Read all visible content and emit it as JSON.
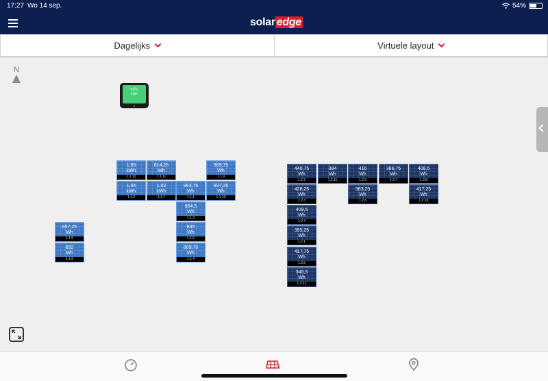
{
  "status": {
    "time": "17:27",
    "date": "Wo 14 sep.",
    "battery": "54%"
  },
  "app": {
    "logo_prefix": "solar",
    "logo_suffix": "edge",
    "accent": "#e11c2a",
    "navy": "#0c1f4f"
  },
  "selectors": {
    "period": "Dagelijks",
    "layout": "Virtuele layout"
  },
  "compass": {
    "label": "N"
  },
  "inverter": {
    "screen_line1": "≈/≈",
    "screen_line2": "kWh",
    "tag": "1"
  },
  "panels": [
    {
      "val": "1,05",
      "unit": "kWh",
      "id": "1.1.10"
    },
    {
      "val": "814,25",
      "unit": "Wh",
      "id": "1.1.11"
    },
    {
      "val": "989,75",
      "unit": "Wh",
      "id": "1.1.9"
    },
    {
      "val": "1,04",
      "unit": "kWh",
      "id": "1.1.2"
    },
    {
      "val": "1,02",
      "unit": "kWh",
      "id": "1.1.7"
    },
    {
      "val": "993,75",
      "unit": "Wh",
      "id": "1.1.1"
    },
    {
      "val": "937,25",
      "unit": "Wh",
      "id": "1.1.10"
    },
    {
      "val": "864,5",
      "unit": "Wh",
      "id": "1.1.3"
    },
    {
      "val": "845",
      "unit": "Wh",
      "id": "1.1.6"
    },
    {
      "val": "809,75",
      "unit": "Wh",
      "id": "1.1.4"
    },
    {
      "val": "857,25",
      "unit": "Wh",
      "id": "1.1.5"
    },
    {
      "val": "832",
      "unit": "Wh",
      "id": "1.1.8"
    },
    {
      "val": "440,75",
      "unit": "Wh",
      "id": "1.2.2"
    },
    {
      "val": "384",
      "unit": "Wh",
      "id": "1.2.11"
    },
    {
      "val": "416",
      "unit": "Wh",
      "id": "1.2.9"
    },
    {
      "val": "386,75",
      "unit": "Wh",
      "id": "1.2.7"
    },
    {
      "val": "408,5",
      "unit": "Wh",
      "id": "1.2.8"
    },
    {
      "val": "428,25",
      "unit": "Wh",
      "id": "1.2.3"
    },
    {
      "val": "383,25",
      "unit": "Wh",
      "id": "1.2.6"
    },
    {
      "val": "417,25",
      "unit": "Wh",
      "id": "1.2.10"
    },
    {
      "val": "409,5",
      "unit": "Wh",
      "id": "1.2.4"
    },
    {
      "val": "395,25",
      "unit": "Wh",
      "id": "1.2.1"
    },
    {
      "val": "417,75",
      "unit": "Wh",
      "id": "1.2.5"
    },
    {
      "val": "340,5",
      "unit": "Wh",
      "id": "1.2.12"
    }
  ],
  "tabs": [
    {
      "icon": "gauge-icon"
    },
    {
      "icon": "solar-panel-icon",
      "active": true
    },
    {
      "icon": "location-pin-icon"
    }
  ]
}
